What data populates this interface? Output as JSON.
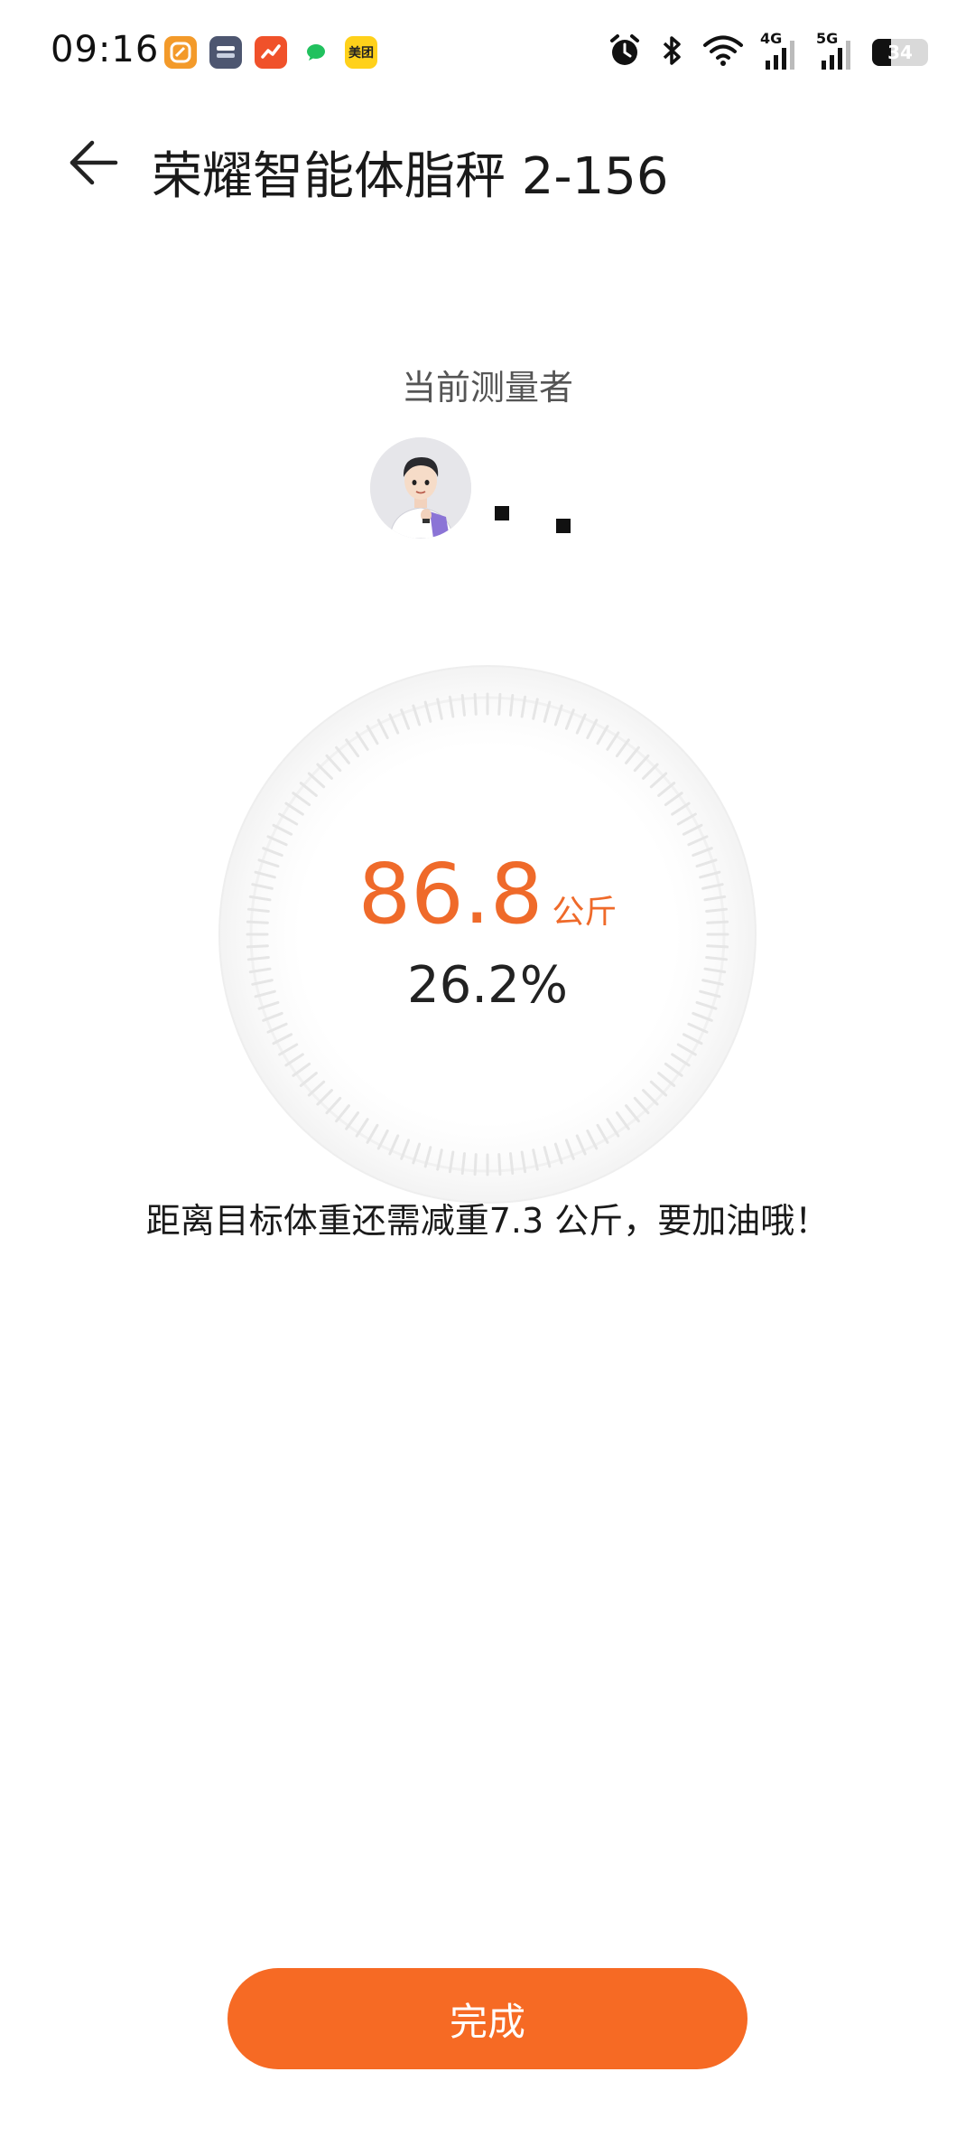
{
  "status_bar": {
    "time": "09:16",
    "notification_icons": [
      {
        "name": "app-orange-icon",
        "color": "#f39a2a",
        "text": ""
      },
      {
        "name": "app-navy-icon",
        "color": "#4d5670",
        "text": ""
      },
      {
        "name": "app-red-chart-icon",
        "color": "#f0512a",
        "text": ""
      },
      {
        "name": "wechat-icon",
        "color": "#ffffff",
        "text": ""
      },
      {
        "name": "meituan-icon",
        "color": "#ffd11a",
        "text": "美团"
      }
    ],
    "signal_1_label": "4G",
    "signal_2_label": "5G",
    "battery_level": "34"
  },
  "header": {
    "title": "荣耀智能体脂秤 2-156"
  },
  "measurer": {
    "label": "当前测量者"
  },
  "result": {
    "weight_value": "86.8",
    "weight_unit": "公斤",
    "body_fat": "26.2%"
  },
  "goal_message": "距离目标体重还需减重7.3 公斤，要加油哦！",
  "done_button_label": "完成",
  "colors": {
    "accent": "#ef6a2a",
    "button": "#f66a24"
  }
}
